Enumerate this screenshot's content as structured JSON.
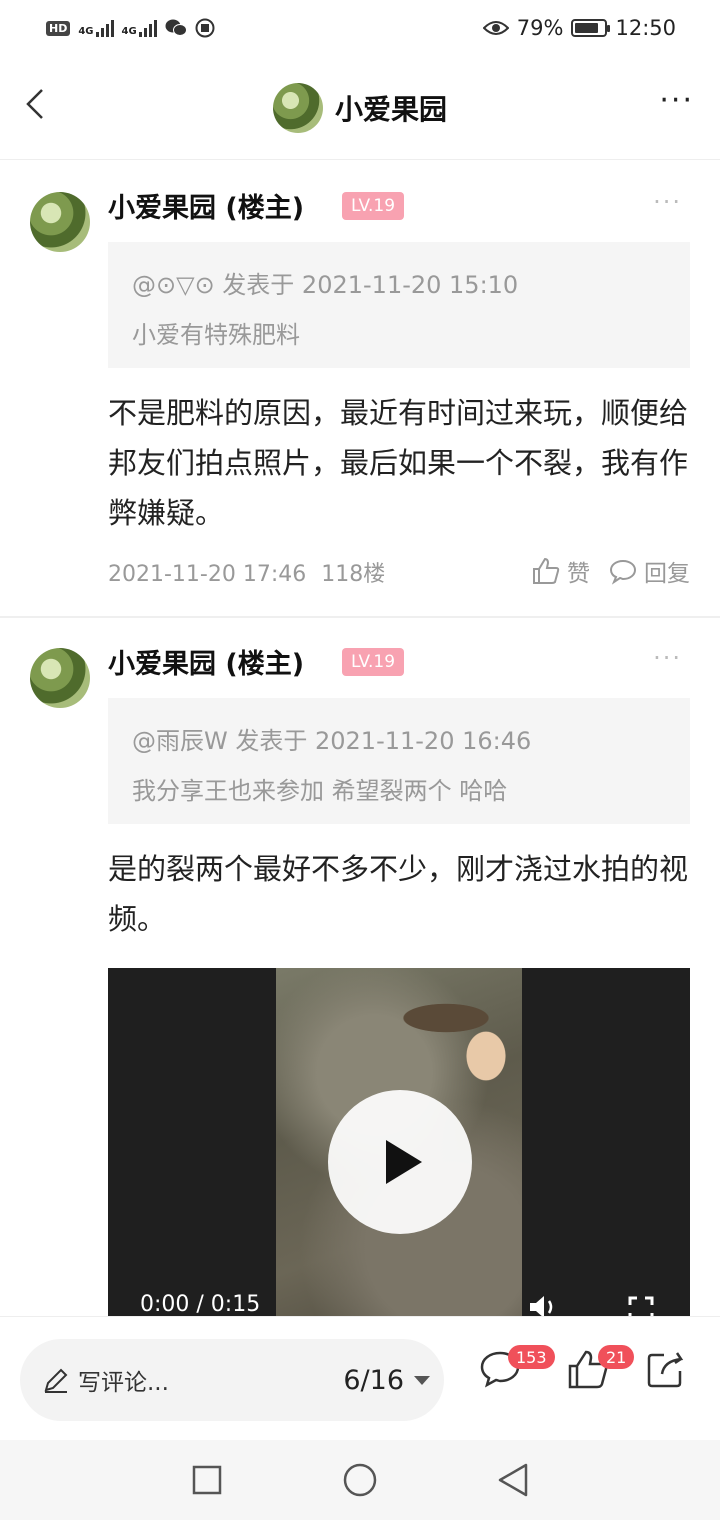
{
  "status_bar": {
    "left_icons": [
      "hd-icon",
      "signal-4g-icon",
      "signal-4g-icon",
      "wechat-icon",
      "app-icon"
    ],
    "hd_label": "HD",
    "net_label_1": "4G",
    "net_label_2": "4G",
    "battery_percent": "79%",
    "battery_level": 0.79,
    "time": "12:50"
  },
  "header": {
    "title": "小爱果园"
  },
  "posts": [
    {
      "author": "小爱果园 (楼主)",
      "level": "LV.19",
      "quote_header": "@⊙▽⊙ 发表于 2021-11-20 15:10",
      "quote_text": "小爱有特殊肥料",
      "body": "不是肥料的原因，最近有时间过来玩，顺便给邦友们拍点照片，最后如果一个不裂，我有作弊嫌疑。",
      "date": "2021-11-20 17:46",
      "floor": "118楼",
      "like_label": "赞",
      "reply_label": "回复"
    },
    {
      "author": "小爱果园 (楼主)",
      "level": "LV.19",
      "quote_header": "@雨辰W 发表于 2021-11-20 16:46",
      "quote_text": "我分享王也来参加 希望裂两个 哈哈",
      "body": "是的裂两个最好不多不少，刚才浇过水拍的视频。",
      "video": {
        "time": "0:00 / 0:15"
      }
    }
  ],
  "bottom_bar": {
    "comment_placeholder": "写评论...",
    "page_indicator": "6/16",
    "comment_count": "153",
    "like_count": "21"
  },
  "colors": {
    "level_badge": "#f8a2b1",
    "count_badge": "#f0505a",
    "quote_bg": "#f5f5f5",
    "meta_text": "#999999"
  }
}
